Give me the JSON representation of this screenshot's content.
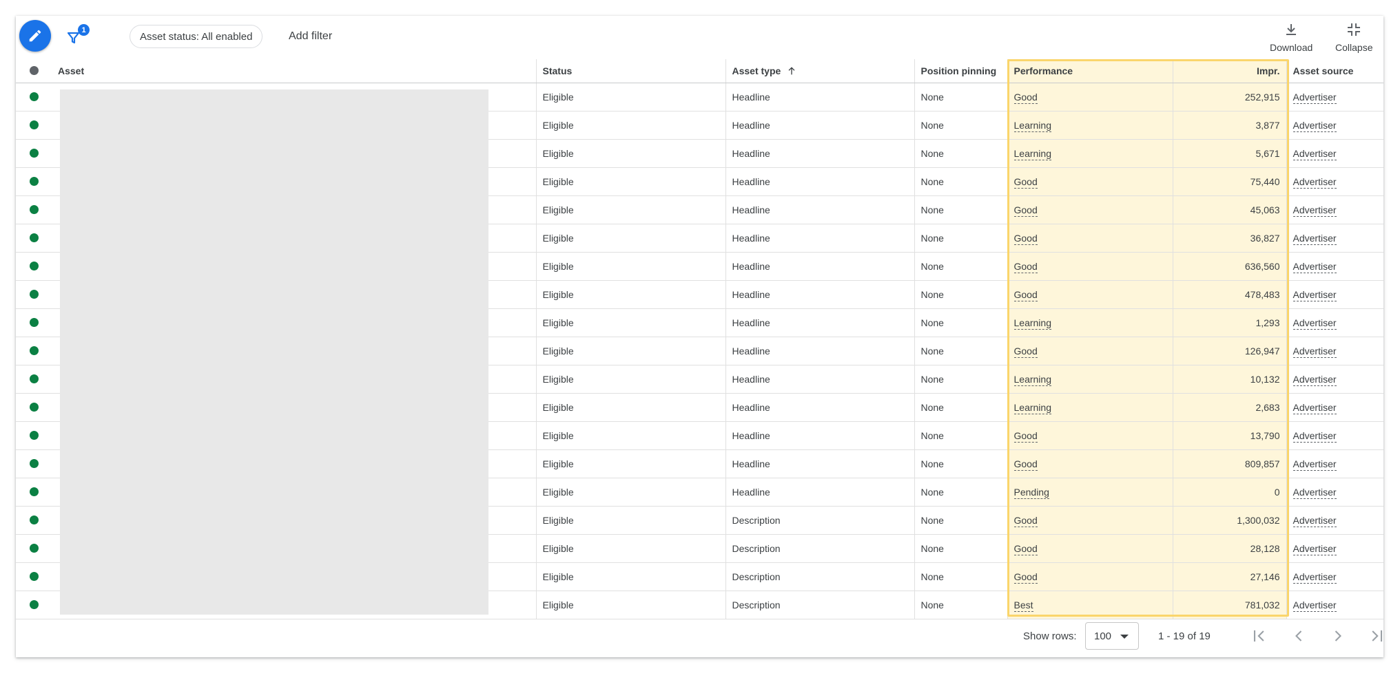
{
  "toolbar": {
    "filter_badge_count": "1",
    "chip_label": "Asset status: All enabled",
    "add_filter_label": "Add filter",
    "download_label": "Download",
    "collapse_label": "Collapse"
  },
  "table": {
    "headers": {
      "asset": "Asset",
      "status": "Status",
      "asset_type": "Asset type",
      "position_pinning": "Position pinning",
      "performance": "Performance",
      "impr": "Impr.",
      "asset_source": "Asset source"
    },
    "sort": {
      "column": "asset_type",
      "direction": "ascending"
    },
    "rows": [
      {
        "status": "Eligible",
        "asset_type": "Headline",
        "pinning": "None",
        "performance": "Good",
        "impr": "252,915",
        "source": "Advertiser"
      },
      {
        "status": "Eligible",
        "asset_type": "Headline",
        "pinning": "None",
        "performance": "Learning",
        "impr": "3,877",
        "source": "Advertiser"
      },
      {
        "status": "Eligible",
        "asset_type": "Headline",
        "pinning": "None",
        "performance": "Learning",
        "impr": "5,671",
        "source": "Advertiser"
      },
      {
        "status": "Eligible",
        "asset_type": "Headline",
        "pinning": "None",
        "performance": "Good",
        "impr": "75,440",
        "source": "Advertiser"
      },
      {
        "status": "Eligible",
        "asset_type": "Headline",
        "pinning": "None",
        "performance": "Good",
        "impr": "45,063",
        "source": "Advertiser"
      },
      {
        "status": "Eligible",
        "asset_type": "Headline",
        "pinning": "None",
        "performance": "Good",
        "impr": "36,827",
        "source": "Advertiser"
      },
      {
        "status": "Eligible",
        "asset_type": "Headline",
        "pinning": "None",
        "performance": "Good",
        "impr": "636,560",
        "source": "Advertiser"
      },
      {
        "status": "Eligible",
        "asset_type": "Headline",
        "pinning": "None",
        "performance": "Good",
        "impr": "478,483",
        "source": "Advertiser"
      },
      {
        "status": "Eligible",
        "asset_type": "Headline",
        "pinning": "None",
        "performance": "Learning",
        "impr": "1,293",
        "source": "Advertiser"
      },
      {
        "status": "Eligible",
        "asset_type": "Headline",
        "pinning": "None",
        "performance": "Good",
        "impr": "126,947",
        "source": "Advertiser"
      },
      {
        "status": "Eligible",
        "asset_type": "Headline",
        "pinning": "None",
        "performance": "Learning",
        "impr": "10,132",
        "source": "Advertiser"
      },
      {
        "status": "Eligible",
        "asset_type": "Headline",
        "pinning": "None",
        "performance": "Learning",
        "impr": "2,683",
        "source": "Advertiser"
      },
      {
        "status": "Eligible",
        "asset_type": "Headline",
        "pinning": "None",
        "performance": "Good",
        "impr": "13,790",
        "source": "Advertiser"
      },
      {
        "status": "Eligible",
        "asset_type": "Headline",
        "pinning": "None",
        "performance": "Good",
        "impr": "809,857",
        "source": "Advertiser"
      },
      {
        "status": "Eligible",
        "asset_type": "Headline",
        "pinning": "None",
        "performance": "Pending",
        "impr": "0",
        "source": "Advertiser"
      },
      {
        "status": "Eligible",
        "asset_type": "Description",
        "pinning": "None",
        "performance": "Good",
        "impr": "1,300,032",
        "source": "Advertiser"
      },
      {
        "status": "Eligible",
        "asset_type": "Description",
        "pinning": "None",
        "performance": "Good",
        "impr": "28,128",
        "source": "Advertiser"
      },
      {
        "status": "Eligible",
        "asset_type": "Description",
        "pinning": "None",
        "performance": "Good",
        "impr": "27,146",
        "source": "Advertiser"
      },
      {
        "status": "Eligible",
        "asset_type": "Description",
        "pinning": "None",
        "performance": "Best",
        "impr": "781,032",
        "source": "Advertiser"
      }
    ]
  },
  "footer": {
    "show_rows_label": "Show rows:",
    "rows_per_page": "100",
    "range_text": "1 - 19 of 19"
  },
  "colors": {
    "accent": "#1a73e8",
    "status_enabled": "#0b8043",
    "highlight_fill": "#fef6da",
    "highlight_border": "#fad56b",
    "redacted": "#e8e8e8"
  },
  "icons": {
    "edit": "pencil-icon",
    "filter": "filter-icon",
    "download": "download-icon",
    "collapse": "collapse-icon",
    "sort": "arrow-up-icon",
    "first_page": "first-page-icon",
    "prev_page": "chevron-left-icon",
    "next_page": "chevron-right-icon",
    "last_page": "last-page-icon"
  }
}
